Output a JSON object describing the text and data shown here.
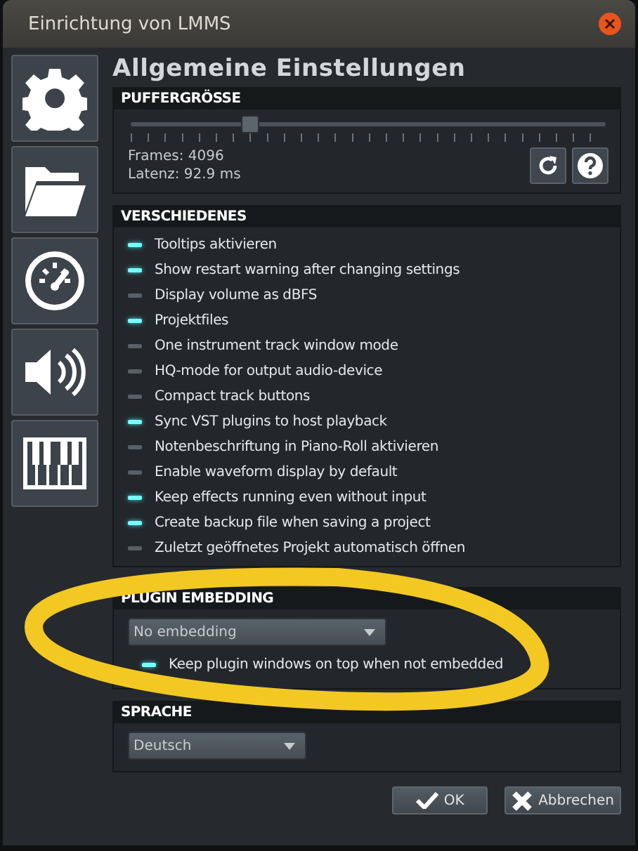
{
  "window": {
    "title": "Einrichtung von LMMS"
  },
  "heading": "Allgemeine Einstellungen",
  "buffer": {
    "title": "PUFFERGRÖSSE",
    "level": 0.25,
    "frames": "Frames: 4096",
    "latency": "Latenz: 92.9 ms"
  },
  "misc": {
    "title": "VERSCHIEDENES",
    "options": [
      {
        "label": "Tooltips aktivieren",
        "checked": true
      },
      {
        "label": "Show restart warning after changing settings",
        "checked": true
      },
      {
        "label": "Display volume as dBFS",
        "checked": false
      },
      {
        "label": "Projektfiles",
        "checked": true
      },
      {
        "label": "One instrument track window mode",
        "checked": false
      },
      {
        "label": "HQ-mode for output audio-device",
        "checked": false
      },
      {
        "label": "Compact track buttons",
        "checked": false
      },
      {
        "label": "Sync VST plugins to host playback",
        "checked": true
      },
      {
        "label": "Notenbeschriftung in Piano-Roll aktivieren",
        "checked": false
      },
      {
        "label": "Enable waveform display by default",
        "checked": false
      },
      {
        "label": "Keep effects running even without input",
        "checked": true
      },
      {
        "label": "Create backup file when saving a project",
        "checked": true
      },
      {
        "label": "Zuletzt geöffnetes Projekt automatisch öffnen",
        "checked": false
      }
    ]
  },
  "plugin_embedding": {
    "title": "PLUGIN EMBEDDING",
    "value": "No embedding",
    "option": {
      "label": "Keep plugin windows on top when not embedded",
      "checked": true
    }
  },
  "language": {
    "title": "SPRACHE",
    "value": "Deutsch"
  },
  "buttons": [
    {
      "label": "OK",
      "kind": "ok"
    },
    {
      "label": "Abbrechen",
      "kind": "cancel"
    }
  ]
}
